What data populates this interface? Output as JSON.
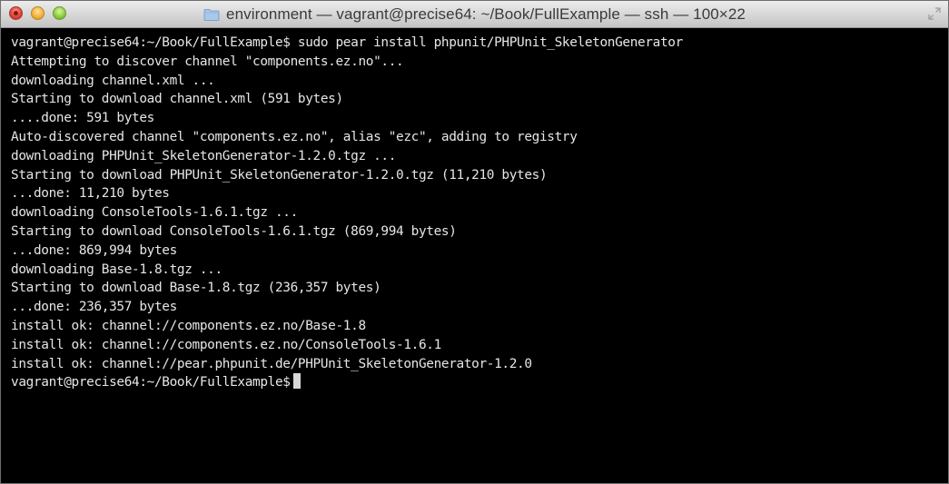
{
  "window": {
    "title": "environment — vagrant@precise64: ~/Book/FullExample — ssh — 100×22",
    "icons": {
      "close": "close-icon",
      "minimize": "minimize-icon",
      "maximize": "maximize-icon",
      "folder": "folder-icon",
      "fullscreen": "fullscreen-icon"
    },
    "colors": {
      "terminal_bg": "#000000",
      "terminal_fg": "#e6e6e6",
      "close": "#e0443a",
      "minimize": "#f2b43a",
      "maximize": "#8ecf3e"
    }
  },
  "terminal": {
    "lines": [
      "vagrant@precise64:~/Book/FullExample$ sudo pear install phpunit/PHPUnit_SkeletonGenerator",
      "Attempting to discover channel \"components.ez.no\"...",
      "downloading channel.xml ...",
      "Starting to download channel.xml (591 bytes)",
      "....done: 591 bytes",
      "Auto-discovered channel \"components.ez.no\", alias \"ezc\", adding to registry",
      "downloading PHPUnit_SkeletonGenerator-1.2.0.tgz ...",
      "Starting to download PHPUnit_SkeletonGenerator-1.2.0.tgz (11,210 bytes)",
      "...done: 11,210 bytes",
      "downloading ConsoleTools-1.6.1.tgz ...",
      "Starting to download ConsoleTools-1.6.1.tgz (869,994 bytes)",
      "...done: 869,994 bytes",
      "downloading Base-1.8.tgz ...",
      "Starting to download Base-1.8.tgz (236,357 bytes)",
      "...done: 236,357 bytes",
      "install ok: channel://components.ez.no/Base-1.8",
      "install ok: channel://components.ez.no/ConsoleTools-1.6.1",
      "install ok: channel://pear.phpunit.de/PHPUnit_SkeletonGenerator-1.2.0"
    ],
    "prompt": "vagrant@precise64:~/Book/FullExample$"
  }
}
